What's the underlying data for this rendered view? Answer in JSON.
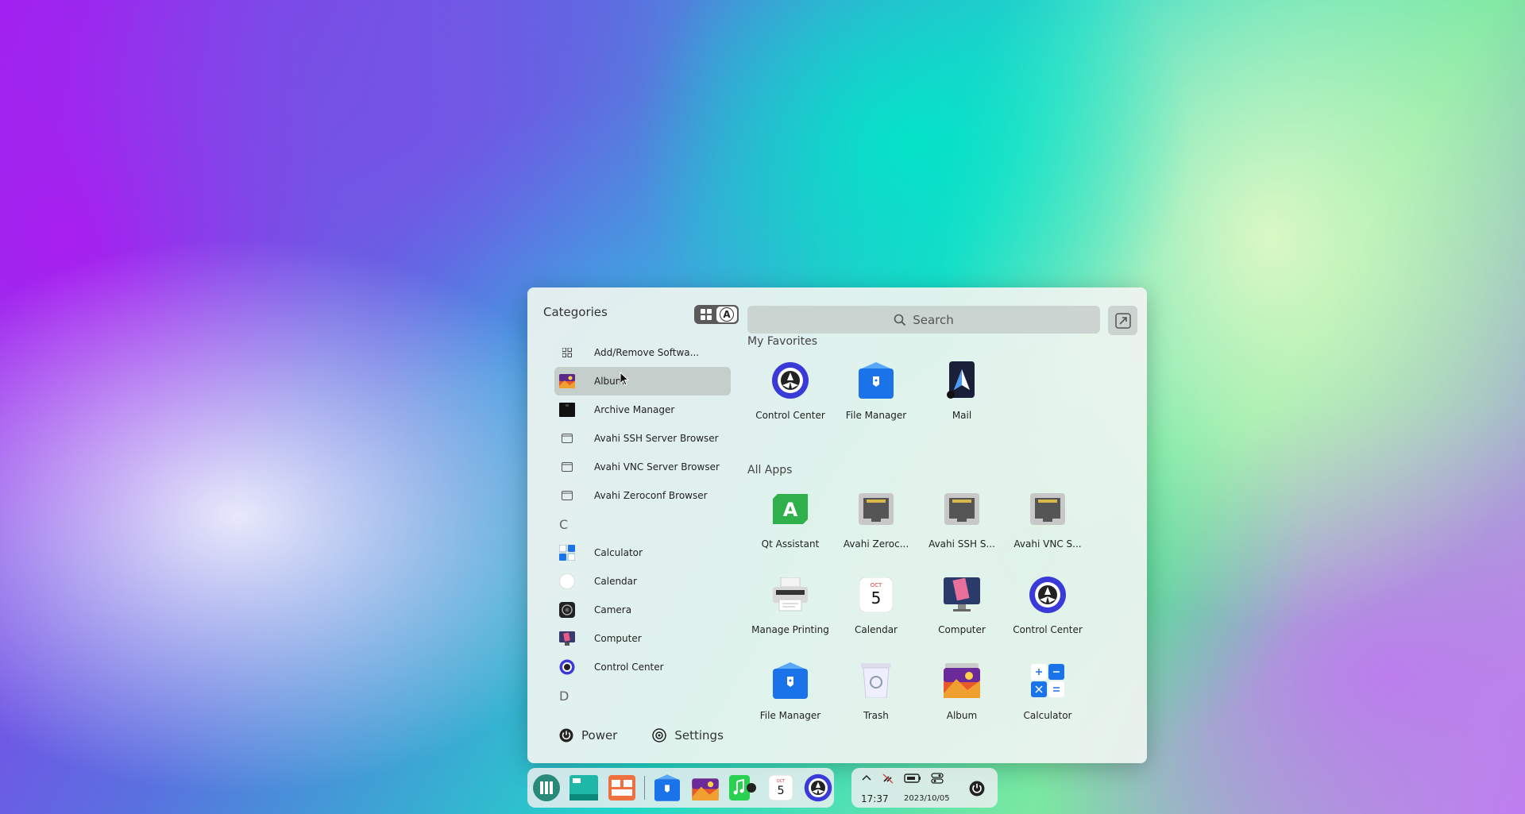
{
  "launcher": {
    "categories_label": "Categories",
    "search_placeholder": "Search",
    "list": [
      {
        "label": "Add/Remove Softwa...",
        "icon": "apps-grid-icon"
      },
      {
        "label": "Album",
        "icon": "album-icon",
        "selected": true
      },
      {
        "label": "Archive Manager",
        "icon": "archive-icon"
      },
      {
        "label": "Avahi SSH Server Browser",
        "icon": "window-icon"
      },
      {
        "label": "Avahi VNC Server Browser",
        "icon": "window-icon"
      },
      {
        "label": "Avahi Zeroconf Browser",
        "icon": "window-icon"
      }
    ],
    "letter_c": "C",
    "list_c": [
      {
        "label": "Calculator",
        "icon": "calculator-icon"
      },
      {
        "label": "Calendar",
        "icon": "calendar-icon"
      },
      {
        "label": "Camera",
        "icon": "camera-icon"
      },
      {
        "label": "Computer",
        "icon": "computer-icon"
      },
      {
        "label": "Control Center",
        "icon": "control-center-icon"
      }
    ],
    "letter_d": "D",
    "power_label": "Power",
    "settings_label": "Settings",
    "favorites_title": "My Favorites",
    "favorites": [
      {
        "label": "Control Center",
        "icon": "control-center-icon"
      },
      {
        "label": "File Manager",
        "icon": "file-manager-icon"
      },
      {
        "label": "Mail",
        "icon": "mail-icon"
      }
    ],
    "all_apps_title": "All Apps",
    "all_apps": [
      {
        "label": "Qt Assistant",
        "icon": "qt-assistant-icon"
      },
      {
        "label": "Avahi Zeroc...",
        "icon": "network-icon"
      },
      {
        "label": "Avahi SSH S...",
        "icon": "network-icon"
      },
      {
        "label": "Avahi VNC S...",
        "icon": "network-icon"
      },
      {
        "label": "Manage Printing",
        "icon": "printer-icon"
      },
      {
        "label": "Calendar",
        "icon": "calendar-icon"
      },
      {
        "label": "Computer",
        "icon": "computer-icon"
      },
      {
        "label": "Control Center",
        "icon": "control-center-icon"
      },
      {
        "label": "File Manager",
        "icon": "file-manager-icon"
      },
      {
        "label": "Trash",
        "icon": "trash-icon"
      },
      {
        "label": "Album",
        "icon": "album-icon"
      },
      {
        "label": "Calculator",
        "icon": "calculator-icon"
      }
    ]
  },
  "calendar_day": "5",
  "calendar_month": "OCT",
  "qt_letter": "A",
  "tray": {
    "time": "17:37",
    "date": "2023/10/05"
  },
  "colors": {
    "accent": "#1a73e8",
    "control_center": "#3a3ad8",
    "qt_green": "#2fb04a"
  }
}
